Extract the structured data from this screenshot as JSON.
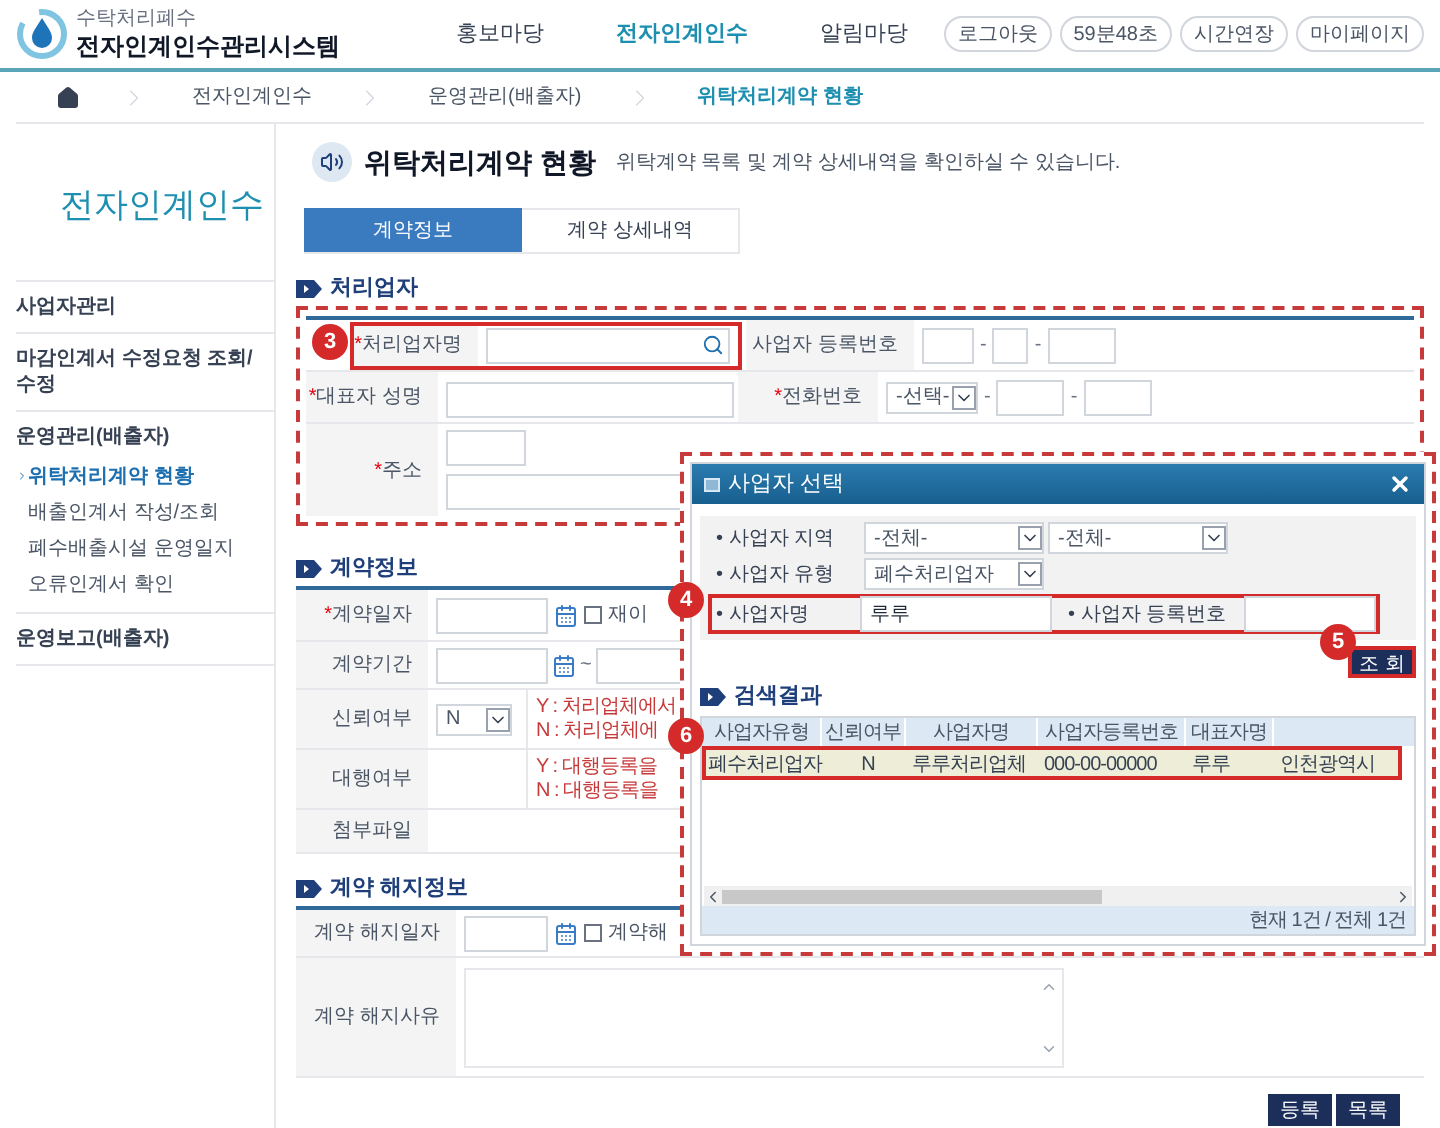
{
  "header": {
    "logo_subtitle": "수탁처리폐수",
    "logo_title": "전자인계인수관리시스템",
    "nav": [
      {
        "label": "홍보마당",
        "selected": false
      },
      {
        "label": "전자인계인수",
        "selected": true
      },
      {
        "label": "알림마당",
        "selected": false
      }
    ],
    "buttons": [
      "로그아웃",
      "59분48초",
      "시간연장",
      "마이페이지"
    ]
  },
  "breadcrumb": [
    "전자인계인수",
    "운영관리(배출자)",
    "위탁처리계약 현황"
  ],
  "sidebar": {
    "title": "전자인계인수",
    "items": [
      {
        "label": "사업자관리"
      },
      {
        "label": "마감인계서 수정요청 조회/수정"
      },
      {
        "label": "운영관리(배출자)",
        "children": [
          {
            "label": "위탁처리계약 현황",
            "selected": true
          },
          {
            "label": "배출인계서 작성/조회",
            "selected": false
          },
          {
            "label": "폐수배출시설 운영일지",
            "selected": false
          },
          {
            "label": "오류인계서 확인",
            "selected": false
          }
        ]
      },
      {
        "label": "운영보고(배출자)"
      }
    ]
  },
  "page": {
    "title": "위탁처리계약 현황",
    "description": "위탁계약 목록 및 계약 상세내역을 확인하실 수 있습니다."
  },
  "tabs": [
    {
      "label": "계약정보",
      "selected": true
    },
    {
      "label": "계약 상세내역",
      "selected": false
    }
  ],
  "processor": {
    "heading": "처리업자",
    "name": {
      "mark": "*",
      "label": "처리업자명"
    },
    "reg_no": {
      "label": "사업자 등록번호",
      "separator": "-"
    },
    "representative": {
      "mark": "*",
      "label": "대표자 성명"
    },
    "phone": {
      "mark": "*",
      "label": "전화번호",
      "select": "-선택-",
      "separator": "-"
    },
    "address": {
      "mark": "*",
      "label": "주소"
    }
  },
  "contract": {
    "heading": "계약정보",
    "date": {
      "mark": "*",
      "label": "계약일자",
      "checkbox": {
        "label": "재이",
        "checked": false
      }
    },
    "period": {
      "label": "계약기간",
      "separator": "~"
    },
    "trust": {
      "label": "신뢰여부",
      "select": "N",
      "notes": [
        "Y : 처리업체에서",
        "N : 처리업체에"
      ]
    },
    "agency": {
      "label": "대행여부",
      "notes": [
        "Y : 대행등록을",
        "N : 대행등록을"
      ]
    },
    "attachment": {
      "label": "첨부파일"
    }
  },
  "termination": {
    "heading": "계약 해지정보",
    "date": {
      "label": "계약 해지일자",
      "checkbox": {
        "label": "계약해",
        "checked": false
      }
    },
    "reason": {
      "label": "계약 해지사유"
    }
  },
  "actions": [
    "등록",
    "목록"
  ],
  "modal": {
    "title": "사업자 선택",
    "region": {
      "label": "• 사업자 지역",
      "selects": [
        "-전체-",
        "-전체-"
      ]
    },
    "type": {
      "label": "• 사업자 유형",
      "select": "폐수처리업자"
    },
    "name": {
      "label": "• 사업자명",
      "value": "루루"
    },
    "reg_no": {
      "label": "• 사업자 등록번호"
    },
    "search_button": "조 회",
    "results": {
      "heading": "검색결과",
      "columns": [
        "사업자유형",
        "신뢰여부",
        "사업자명",
        "사업자등록번호",
        "대표자명"
      ],
      "rows": [
        {
          "cells": [
            "폐수처리업자",
            "N",
            "루루처리업체",
            "000-00-00000",
            "루루",
            "인천광역시"
          ],
          "selected": true
        }
      ],
      "status": "현재 1건 / 전체 1건"
    }
  },
  "steps": [
    "3",
    "4",
    "5",
    "6"
  ]
}
